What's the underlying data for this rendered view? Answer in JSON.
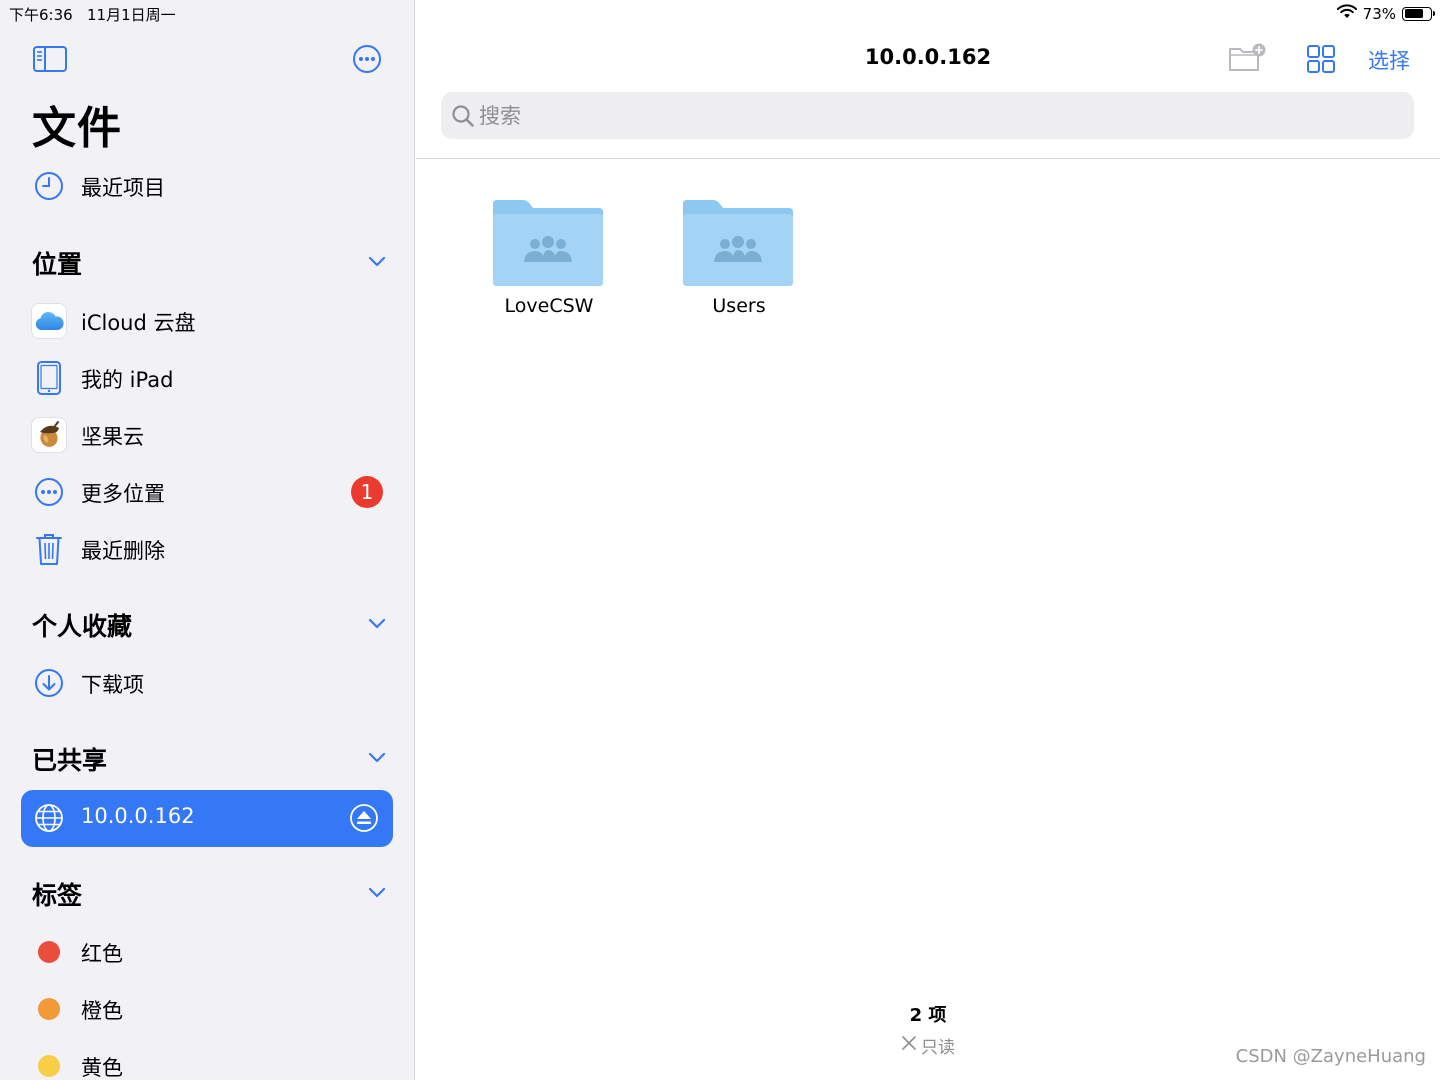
{
  "status": {
    "time": "下午6:36",
    "date": "11月1日周一",
    "battery": "73%",
    "battery_level": 0.73
  },
  "sidebar": {
    "title": "文件",
    "recents": {
      "label": "最近项目",
      "icon": "clock-icon"
    },
    "sections": {
      "locations": {
        "title": "位置",
        "items": [
          {
            "label": "iCloud 云盘",
            "icon": "icloud-icon"
          },
          {
            "label": "我的 iPad",
            "icon": "ipad-icon"
          },
          {
            "label": "坚果云",
            "icon": "nutstore-icon"
          },
          {
            "label": "更多位置",
            "icon": "ellipsis-circle-icon",
            "badge": "1"
          },
          {
            "label": "最近删除",
            "icon": "trash-icon"
          }
        ]
      },
      "favorites": {
        "title": "个人收藏",
        "items": [
          {
            "label": "下载项",
            "icon": "download-icon"
          }
        ]
      },
      "shared": {
        "title": "已共享",
        "items": [
          {
            "label": "10.0.0.162",
            "icon": "globe-icon",
            "selected": true
          }
        ]
      },
      "tags": {
        "title": "标签",
        "items": [
          {
            "label": "红色",
            "color": "#eb4d3d"
          },
          {
            "label": "橙色",
            "color": "#f19a38"
          },
          {
            "label": "黄色",
            "color": "#f7ce46"
          }
        ]
      }
    }
  },
  "main": {
    "title": "10.0.0.162",
    "select_label": "选择",
    "search_placeholder": "搜索",
    "folders": [
      {
        "name": "LoveCSW",
        "icon": "shared-folder-icon"
      },
      {
        "name": "Users",
        "icon": "shared-folder-icon"
      }
    ],
    "footer": {
      "count": "2 项",
      "readonly": "只读"
    }
  },
  "watermark": "CSDN @ZayneHuang",
  "colors": {
    "accent": "#3478f6",
    "sidebar_bg": "#f2f1f6",
    "badge": "#eb3b2e",
    "folder": "#a4d4f5"
  }
}
